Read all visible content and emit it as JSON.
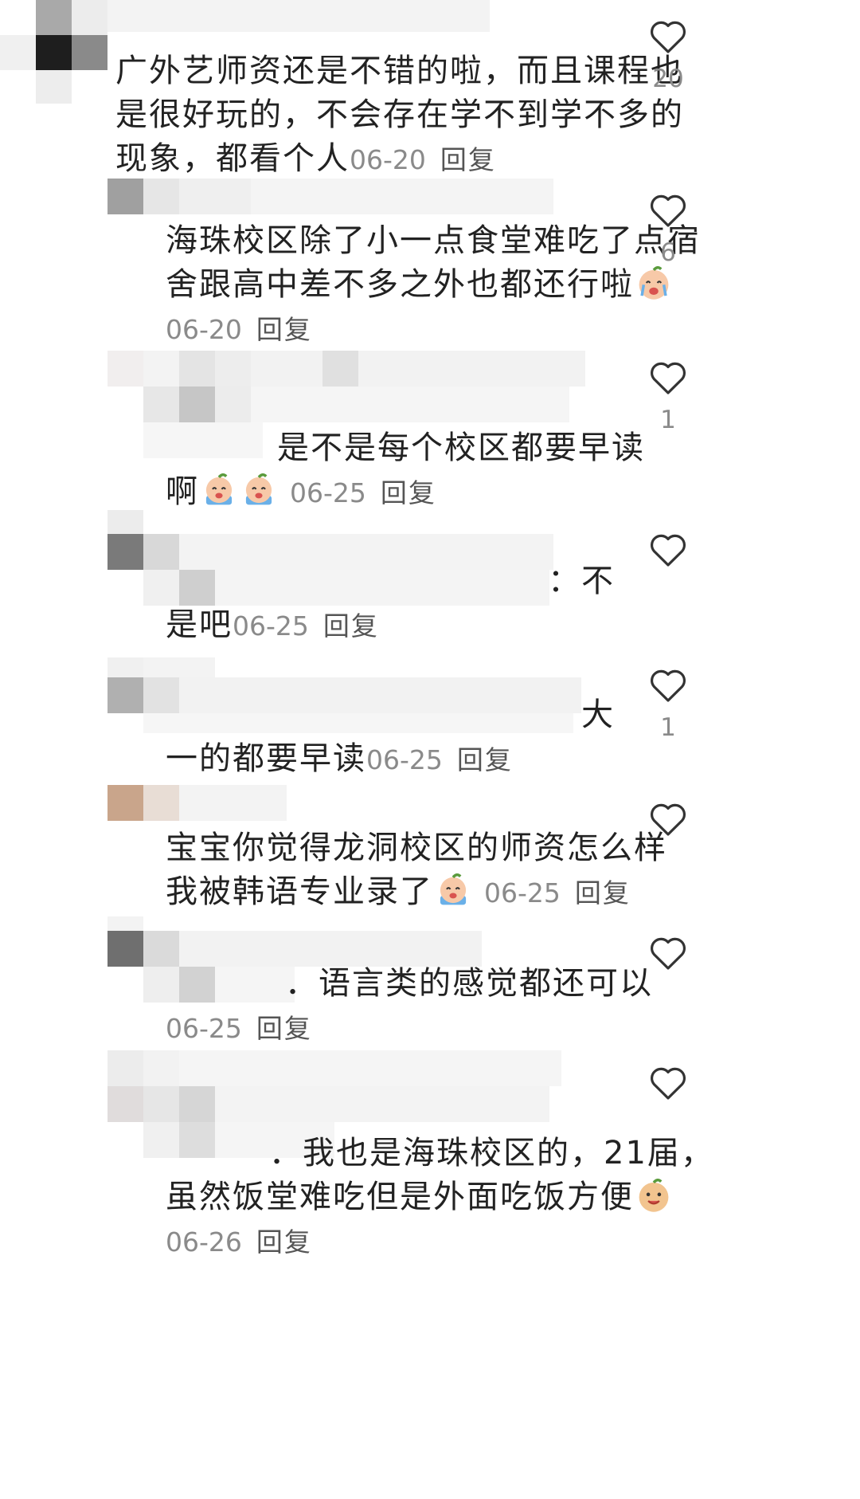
{
  "comments": [
    {
      "lines": [
        "广外艺师资还是不错的啦，而且课程也",
        "是很好玩的，不会存在学不到学不多的",
        "现象，都看个人"
      ],
      "date": "06-20",
      "reply": "回复",
      "likes": "20"
    },
    {
      "lines": [
        "海珠校区除了小一点食堂难吃了点宿",
        "舍跟高中差不多之外也都还行啦"
      ],
      "date": "06-20",
      "reply": "回复",
      "likes": "6"
    },
    {
      "lines": [
        "是不是每个校区都要早读",
        "啊"
      ],
      "date": "06-25",
      "reply": "回复",
      "likes": "1"
    },
    {
      "lines": [
        "：不",
        "是吧"
      ],
      "date": "06-25",
      "reply": "回复",
      "likes": ""
    },
    {
      "lines": [
        "大",
        "一的都要早读"
      ],
      "date": "06-25",
      "reply": "回复",
      "likes": "1"
    },
    {
      "lines": [
        "宝宝你觉得龙洞校区的师资怎么样",
        "我被韩语专业录了"
      ],
      "date": "06-25",
      "reply": "回复",
      "likes": ""
    },
    {
      "lines": [
        "．语言类的感觉都还可以"
      ],
      "date": "06-25",
      "reply": "回复",
      "likes": ""
    },
    {
      "lines": [
        "．我也是海珠校区的，21届，",
        "虽然饭堂难吃但是外面吃饭方便"
      ],
      "date": "06-26",
      "reply": "回复",
      "likes": ""
    }
  ],
  "icons": {
    "like": "heart-outline-icon",
    "emoji_cry": "crying-face-emoji",
    "emoji_happy": "happy-face-emoji"
  },
  "colors": {
    "text": "#222222",
    "meta": "#8a8a8a",
    "icon": "#333333"
  }
}
